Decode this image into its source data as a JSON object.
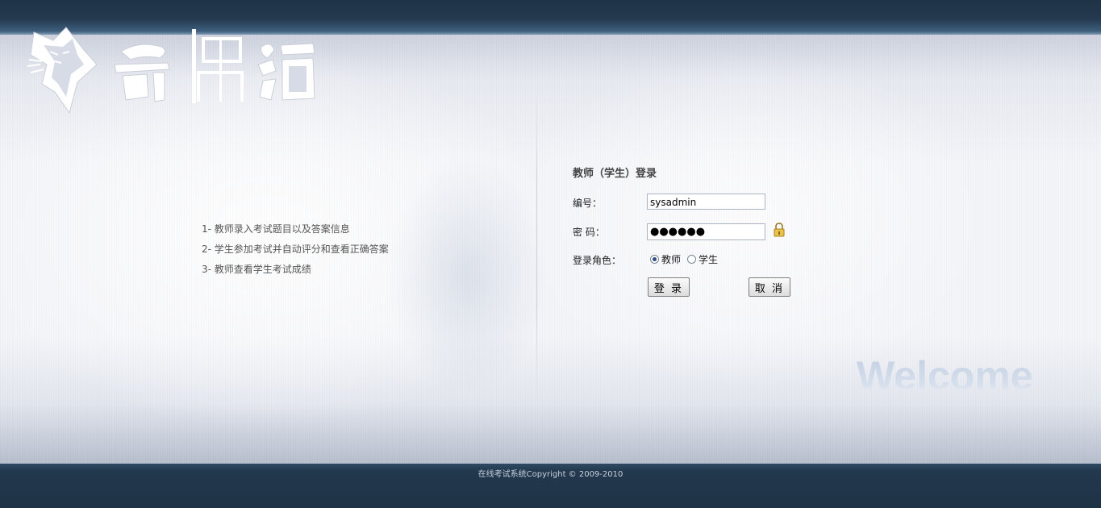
{
  "header": {
    "logo_text": "奇偶猫"
  },
  "features": [
    "1- 教师录入考试题目以及答案信息",
    "2- 学生参加考试并自动评分和查看正确答案",
    "3- 教师查看学生考试成绩"
  ],
  "login": {
    "title": "教师（学生）登录",
    "id_label": "编号：",
    "id_value": "sysadmin",
    "password_label": "密 码：",
    "password_value": "●●●●●●",
    "role_label": "登录角色：",
    "roles": [
      {
        "label": "教师",
        "checked": true
      },
      {
        "label": "学生",
        "checked": false
      }
    ],
    "login_button": "登 录",
    "cancel_button": "取 消"
  },
  "welcome_text": "Welcome",
  "footer": {
    "copyright": "在线考试系统Copyright © 2009-2010"
  },
  "colors": {
    "header_bar": "#1f3346",
    "footer_bar": "#1f3346",
    "welcome_text": "#c5d2e4"
  }
}
